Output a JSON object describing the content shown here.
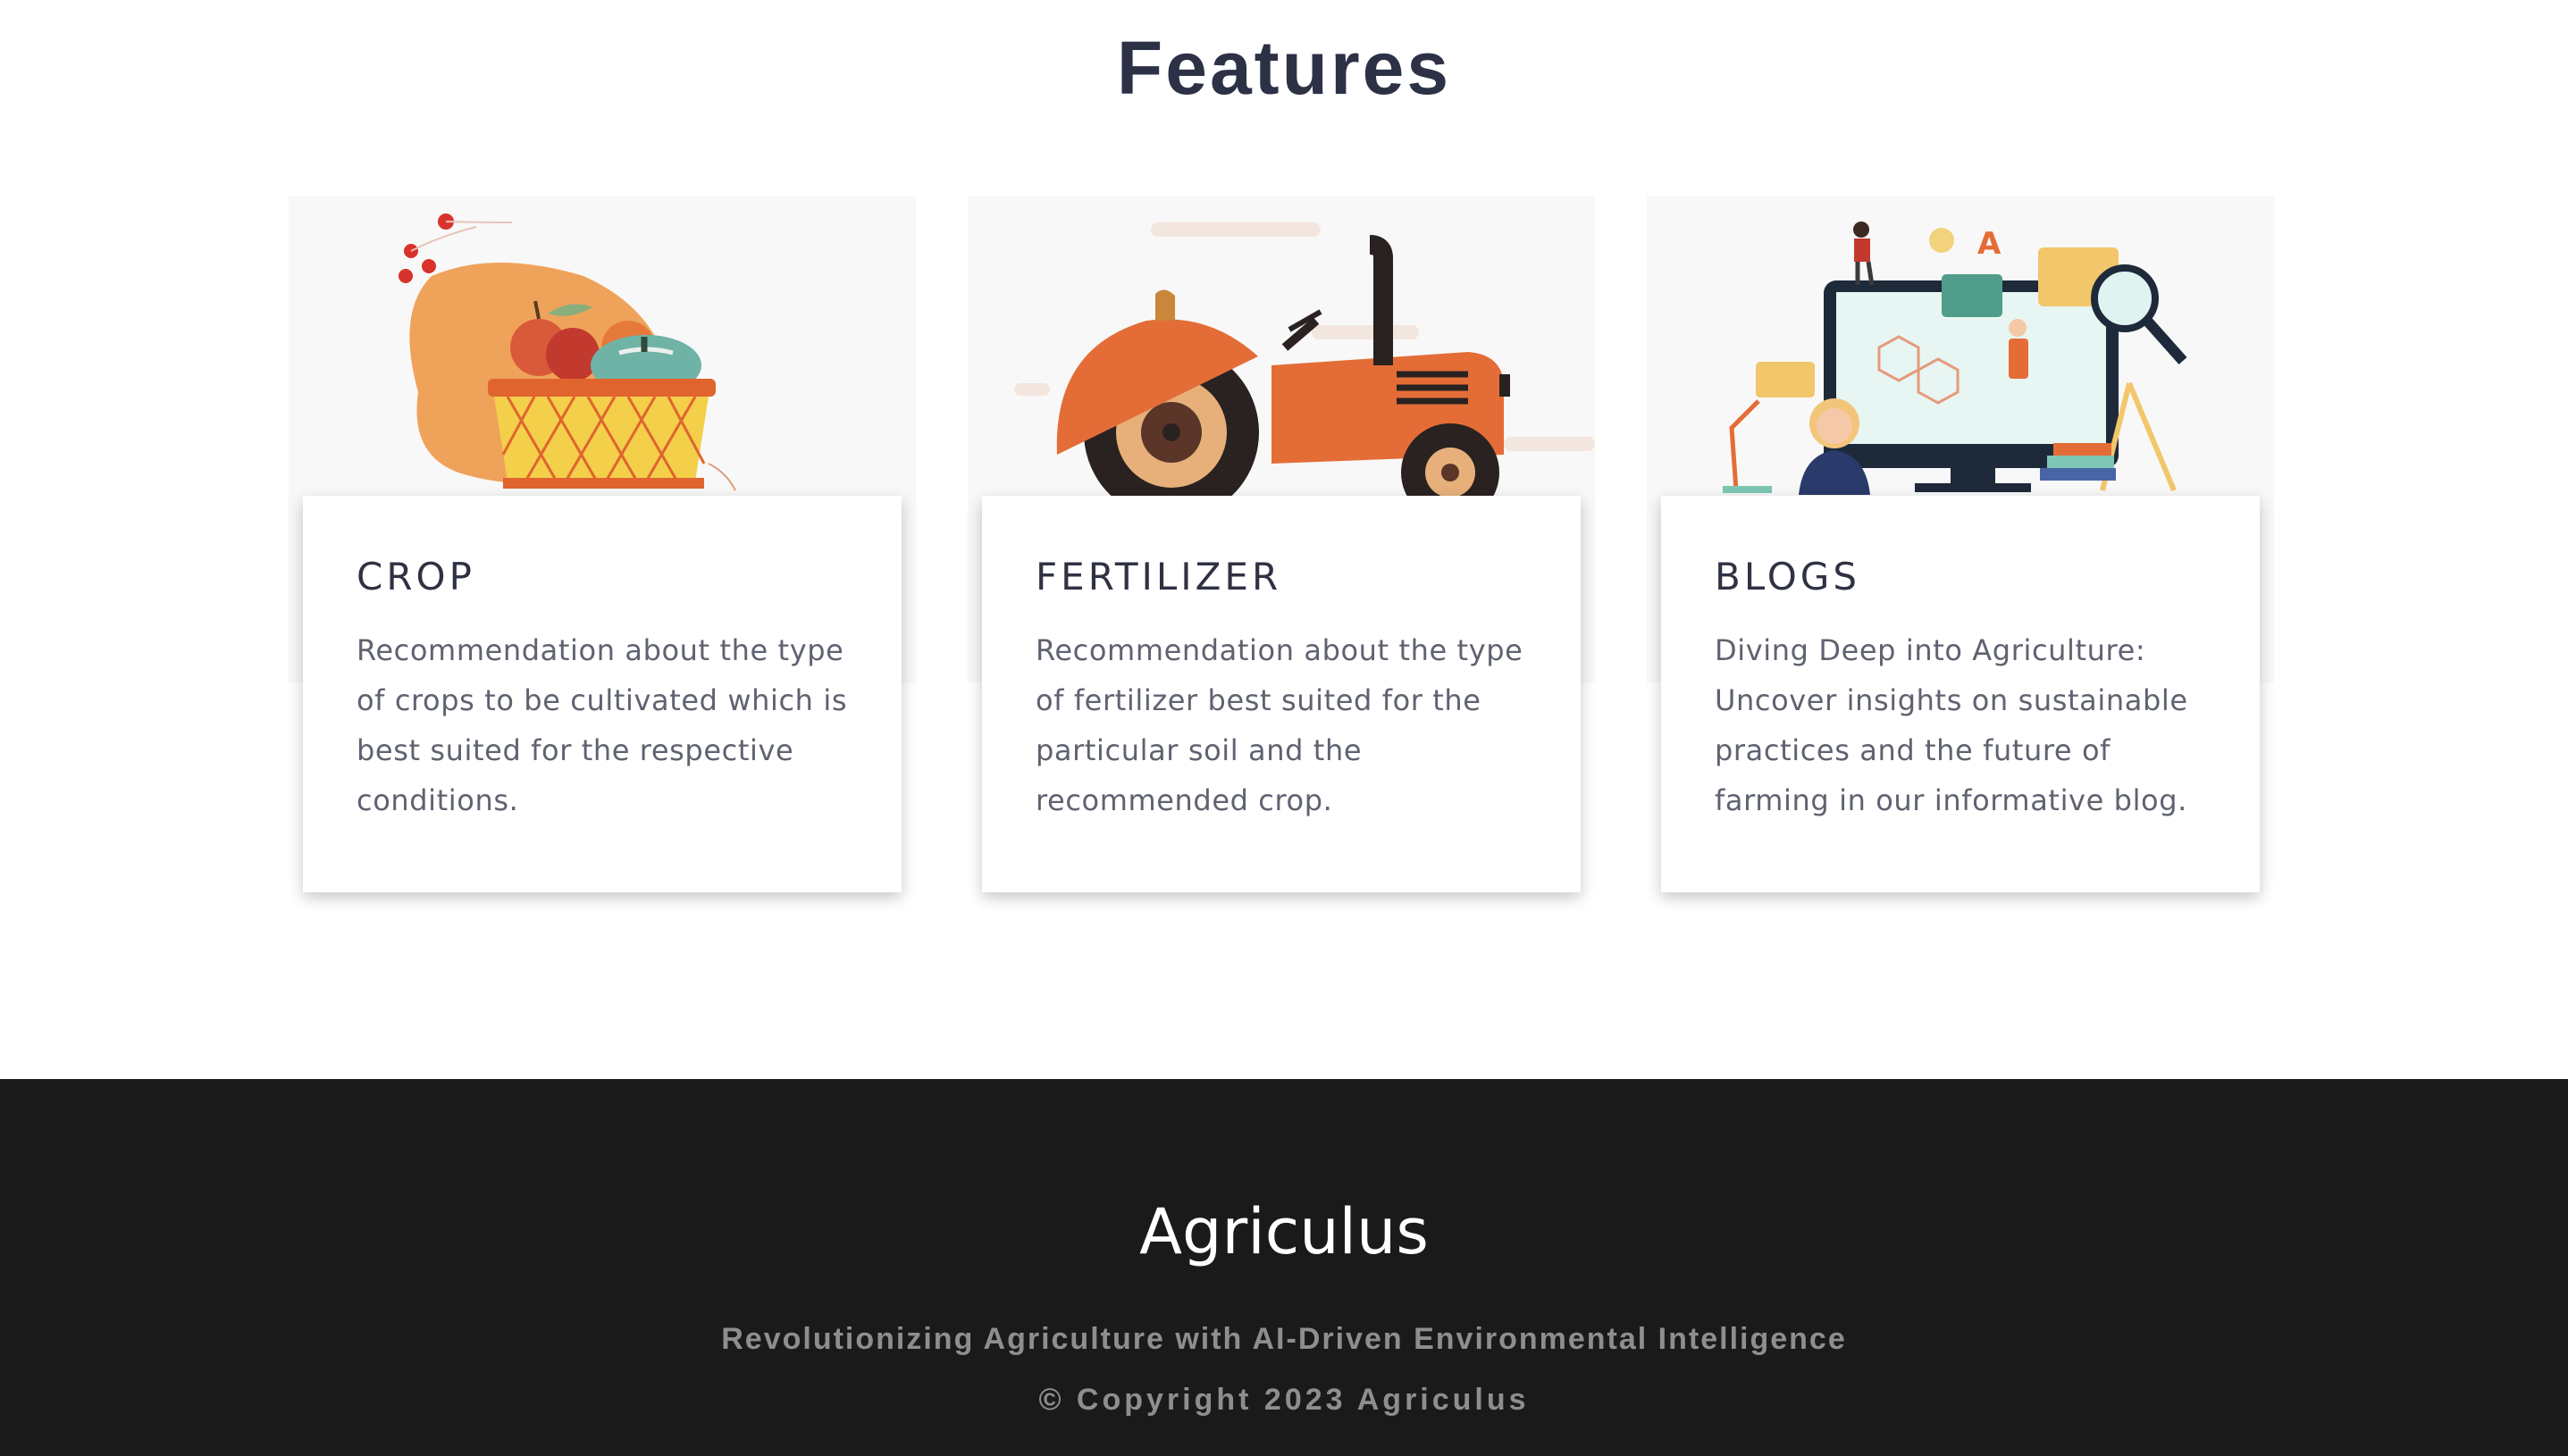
{
  "features": {
    "heading": "Features",
    "cards": [
      {
        "title": "CROP",
        "text": "Recommendation about the type of crops to be cultivated which is best suited for the respective conditions.",
        "illustration": "fruit-basket-illustration"
      },
      {
        "title": "FERTILIZER",
        "text": "Recommendation about the type of fertilizer best suited for the particular soil and the recommended crop.",
        "illustration": "tractor-illustration"
      },
      {
        "title": "BLOGS",
        "text": "Diving Deep into Agriculture: Uncover insights on sustainable practices and the future of farming in our informative blog.",
        "illustration": "research-monitor-illustration"
      }
    ]
  },
  "footer": {
    "brand": "Agriculus",
    "tagline": "Revolutionizing Agriculture with AI-Driven Environmental Intelligence",
    "copyright": "© Copyright 2023 Agriculus"
  },
  "colors": {
    "heading": "#2c3146",
    "footer_bg": "#1a1a1a",
    "accent_orange": "#e46d37"
  }
}
